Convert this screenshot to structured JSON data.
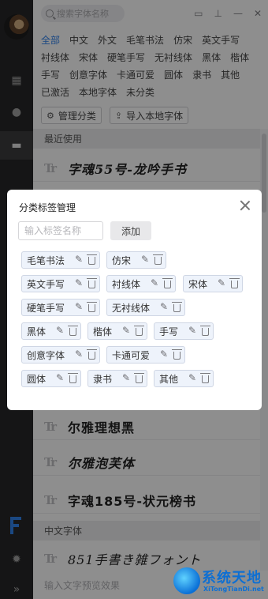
{
  "search": {
    "placeholder": "搜索字体名称"
  },
  "categories": [
    "全部",
    "中文",
    "外文",
    "毛笔书法",
    "仿宋",
    "英文手写",
    "衬线体",
    "宋体",
    "硬笔手写",
    "无衬线体",
    "黑体",
    "楷体",
    "手写",
    "创意字体",
    "卡通可爱",
    "圆体",
    "隶书",
    "其他",
    "已激活",
    "本地字体",
    "未分类"
  ],
  "active_category": "全部",
  "tools": {
    "manage": "管理分类",
    "import": "导入本地字体"
  },
  "sections": {
    "recent": "最近使用",
    "chinese": "中文字体"
  },
  "font_rows": {
    "r1": "字魂55号-龙吟手书",
    "r2": "尔雅理想黑",
    "r3": "尔雅泡芙体",
    "r4": "字魂185号-状元榜书",
    "r5": "851手書き雑フォント"
  },
  "preview": {
    "placeholder": "输入文字预览效果"
  },
  "dialog": {
    "title": "分类标签管理",
    "input_placeholder": "输入标签名称",
    "add_label": "添加",
    "tags": [
      "毛笔书法",
      "仿宋",
      "英文手写",
      "衬线体",
      "宋体",
      "硬笔手写",
      "无衬线体",
      "黑体",
      "楷体",
      "手写",
      "创意字体",
      "卡通可爱",
      "圆体",
      "隶书",
      "其他"
    ]
  },
  "watermark": {
    "title": "系统天地",
    "url": "XiTongTianDi.net"
  },
  "colors": {
    "accent": "#2f7de1",
    "rail": "#252526",
    "overlay": "rgba(0,0,0,0.42)"
  }
}
